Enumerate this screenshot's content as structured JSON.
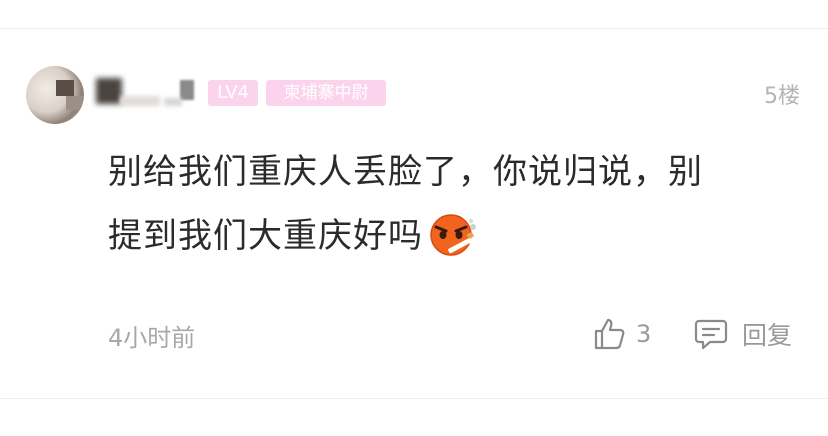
{
  "comment": {
    "level": "LV4",
    "title_badge": "柬埔寨中尉",
    "floor": "5楼",
    "lines": [
      "别给我们重庆人丢脸了，你说归说，别",
      "提到我们大重庆好吗"
    ],
    "emoji": "smoking-angry-face-emoji",
    "time": "4小时前",
    "likes": "3",
    "reply_label": "回复"
  },
  "colors": {
    "badge_bg": "#fcd3ec",
    "text": "#2b2b2b",
    "muted": "#a8a8a8"
  }
}
